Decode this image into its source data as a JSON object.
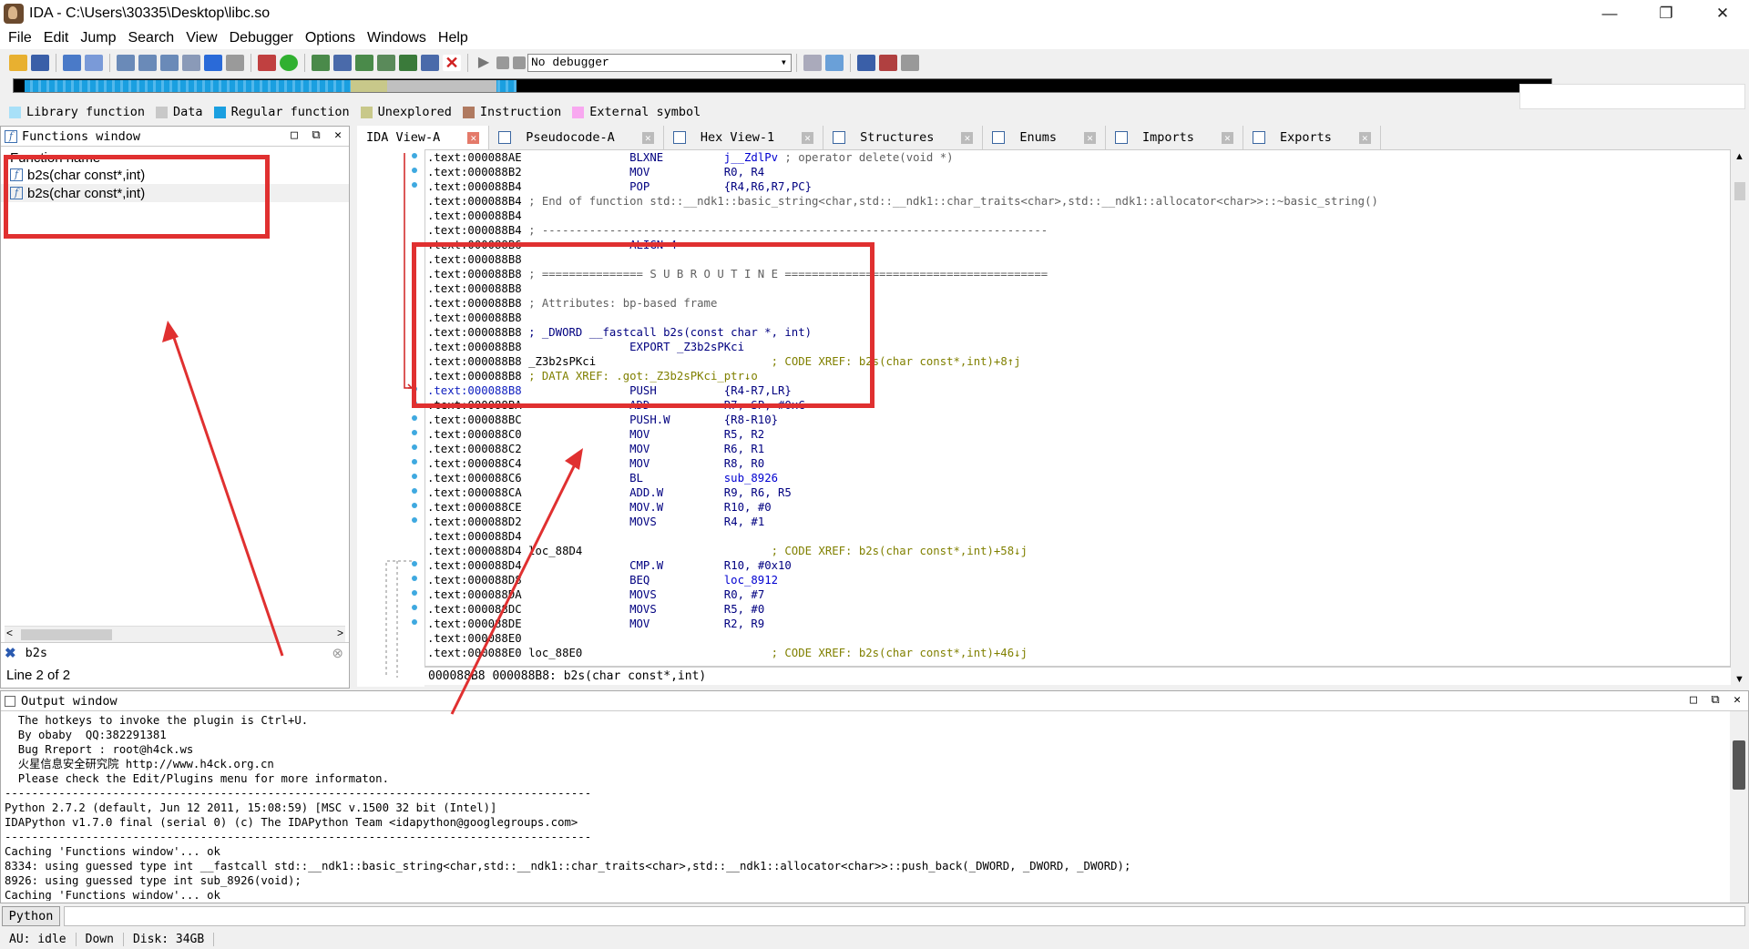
{
  "window": {
    "title": "IDA - C:\\Users\\30335\\Desktop\\libc.so",
    "minimize": "—",
    "restore": "❐",
    "close": "✕"
  },
  "menu": [
    "File",
    "Edit",
    "Jump",
    "Search",
    "View",
    "Debugger",
    "Options",
    "Windows",
    "Help"
  ],
  "toolbar": {
    "debugger_select": "No debugger"
  },
  "legend": [
    {
      "label": "Library function",
      "color": "#a8e0f8"
    },
    {
      "label": "Data",
      "color": "#c8c8c8"
    },
    {
      "label": "Regular function",
      "color": "#1a9fe0"
    },
    {
      "label": "Unexplored",
      "color": "#c8c88a"
    },
    {
      "label": "Instruction",
      "color": "#b07a60"
    },
    {
      "label": "External symbol",
      "color": "#f8a8f0"
    }
  ],
  "functions_window": {
    "title": "Functions window",
    "column": "Function name",
    "rows": [
      "b2s(char const*,int)",
      "b2s(char const*,int)"
    ],
    "filter": "b2s",
    "line_info": "Line 2 of 2"
  },
  "tabs": [
    {
      "label": "IDA View-A"
    },
    {
      "label": "Pseudocode-A"
    },
    {
      "label": "Hex View-1"
    },
    {
      "label": "Structures"
    },
    {
      "label": "Enums"
    },
    {
      "label": "Imports"
    },
    {
      "label": "Exports"
    }
  ],
  "disasm": [
    {
      "addr": ".text:000088AE",
      "label": "",
      "mn": "BLXNE",
      "op": "j__ZdlPv",
      "cm": " ; operator delete(void *)"
    },
    {
      "addr": ".text:000088B2",
      "label": "",
      "mn": "MOV",
      "op": "R0, R4",
      "cm": ""
    },
    {
      "addr": ".text:000088B4",
      "label": "",
      "mn": "POP",
      "op": "{R4,R6,R7,PC}",
      "cm": ""
    },
    {
      "addr": ".text:000088B4",
      "label": "",
      "mn": "",
      "op": "",
      "cm": "; End of function std::__ndk1::basic_string<char,std::__ndk1::char_traits<char>,std::__ndk1::allocator<char>>::~basic_string()"
    },
    {
      "addr": ".text:000088B4",
      "label": "",
      "mn": "",
      "op": "",
      "cm": ""
    },
    {
      "addr": ".text:000088B4",
      "label": "",
      "mn": "",
      "op": "",
      "cm": "; ---------------------------------------------------------------------------"
    },
    {
      "addr": ".text:000088B6",
      "label": "",
      "mn": "ALIGN 4",
      "op": "",
      "cm": ""
    },
    {
      "addr": ".text:000088B8",
      "label": "",
      "mn": "",
      "op": "",
      "cm": ""
    },
    {
      "addr": ".text:000088B8",
      "label": "",
      "mn": "",
      "op": "",
      "cm": "; =============== S U B R O U T I N E ======================================="
    },
    {
      "addr": ".text:000088B8",
      "label": "",
      "mn": "",
      "op": "",
      "cm": ""
    },
    {
      "addr": ".text:000088B8",
      "label": "",
      "mn": "",
      "op": "",
      "cm": "; Attributes: bp-based frame"
    },
    {
      "addr": ".text:000088B8",
      "label": "",
      "mn": "",
      "op": "",
      "cm": ""
    },
    {
      "addr": ".text:000088B8",
      "label": "",
      "mn": "",
      "op": "",
      "cm": "; _DWORD __fastcall b2s(const char *, int)"
    },
    {
      "addr": ".text:000088B8",
      "label": "",
      "mn": "EXPORT _Z3b2sPKci",
      "op": "",
      "cm": ""
    },
    {
      "addr": ".text:000088B8",
      "label": "_Z3b2sPKci",
      "mn": "",
      "op": "",
      "cm": "; CODE XREF: b2s(char const*,int)+8↑j"
    },
    {
      "addr": ".text:000088B8",
      "label": "",
      "mn": "",
      "op": "",
      "cm": "; DATA XREF: .got:_Z3b2sPKci_ptr↓o"
    },
    {
      "addr": ".text:000088B8",
      "label": "",
      "mn": "PUSH",
      "op": "{R4-R7,LR}",
      "cm": ""
    },
    {
      "addr": ".text:000088BA",
      "label": "",
      "mn": "ADD",
      "op": "R7, SP, #0xC",
      "cm": ""
    },
    {
      "addr": ".text:000088BC",
      "label": "",
      "mn": "PUSH.W",
      "op": "{R8-R10}",
      "cm": ""
    },
    {
      "addr": ".text:000088C0",
      "label": "",
      "mn": "MOV",
      "op": "R5, R2",
      "cm": ""
    },
    {
      "addr": ".text:000088C2",
      "label": "",
      "mn": "MOV",
      "op": "R6, R1",
      "cm": ""
    },
    {
      "addr": ".text:000088C4",
      "label": "",
      "mn": "MOV",
      "op": "R8, R0",
      "cm": ""
    },
    {
      "addr": ".text:000088C6",
      "label": "",
      "mn": "BL",
      "op": "sub_8926",
      "cm": ""
    },
    {
      "addr": ".text:000088CA",
      "label": "",
      "mn": "ADD.W",
      "op": "R9, R6, R5",
      "cm": ""
    },
    {
      "addr": ".text:000088CE",
      "label": "",
      "mn": "MOV.W",
      "op": "R10, #0",
      "cm": ""
    },
    {
      "addr": ".text:000088D2",
      "label": "",
      "mn": "MOVS",
      "op": "R4, #1",
      "cm": ""
    },
    {
      "addr": ".text:000088D4",
      "label": "",
      "mn": "",
      "op": "",
      "cm": ""
    },
    {
      "addr": ".text:000088D4",
      "label": "loc_88D4",
      "mn": "",
      "op": "",
      "cm": "; CODE XREF: b2s(char const*,int)+58↓j"
    },
    {
      "addr": ".text:000088D4",
      "label": "",
      "mn": "CMP.W",
      "op": "R10, #0x10",
      "cm": ""
    },
    {
      "addr": ".text:000088D8",
      "label": "",
      "mn": "BEQ",
      "op": "loc_8912",
      "cm": ""
    },
    {
      "addr": ".text:000088DA",
      "label": "",
      "mn": "MOVS",
      "op": "R0, #7",
      "cm": ""
    },
    {
      "addr": ".text:000088DC",
      "label": "",
      "mn": "MOVS",
      "op": "R5, #0",
      "cm": ""
    },
    {
      "addr": ".text:000088DE",
      "label": "",
      "mn": "MOV",
      "op": "R2, R9",
      "cm": ""
    },
    {
      "addr": ".text:000088E0",
      "label": "",
      "mn": "",
      "op": "",
      "cm": ""
    },
    {
      "addr": ".text:000088E0",
      "label": "loc_88E0",
      "mn": "",
      "op": "",
      "cm": "; CODE XREF: b2s(char const*,int)+46↓j"
    }
  ],
  "addr_bar": "000088B8 000088B8: b2s(char const*,int)",
  "output_window": {
    "title": "Output window",
    "lines": [
      "  The hotkeys to invoke the plugin is Ctrl+U.",
      "  By obaby  QQ:382291381",
      "  Bug Rreport : root@h4ck.ws",
      "  火星信息安全研究院 http://www.h4ck.org.cn",
      "  Please check the Edit/Plugins menu for more informaton.",
      "---------------------------------------------------------------------------------------",
      "Python 2.7.2 (default, Jun 12 2011, 15:08:59) [MSC v.1500 32 bit (Intel)]",
      "IDAPython v1.7.0 final (serial 0) (c) The IDAPython Team <idapython@googlegroups.com>",
      "---------------------------------------------------------------------------------------",
      "Caching 'Functions window'... ok",
      "8334: using guessed type int __fastcall std::__ndk1::basic_string<char,std::__ndk1::char_traits<char>,std::__ndk1::allocator<char>>::push_back(_DWORD, _DWORD, _DWORD);",
      "8926: using guessed type int sub_8926(void);",
      "Caching 'Functions window'... ok"
    ]
  },
  "python_button": "Python",
  "status": {
    "au": "AU:  idle",
    "dir": "Down",
    "disk": "Disk: 34GB"
  }
}
